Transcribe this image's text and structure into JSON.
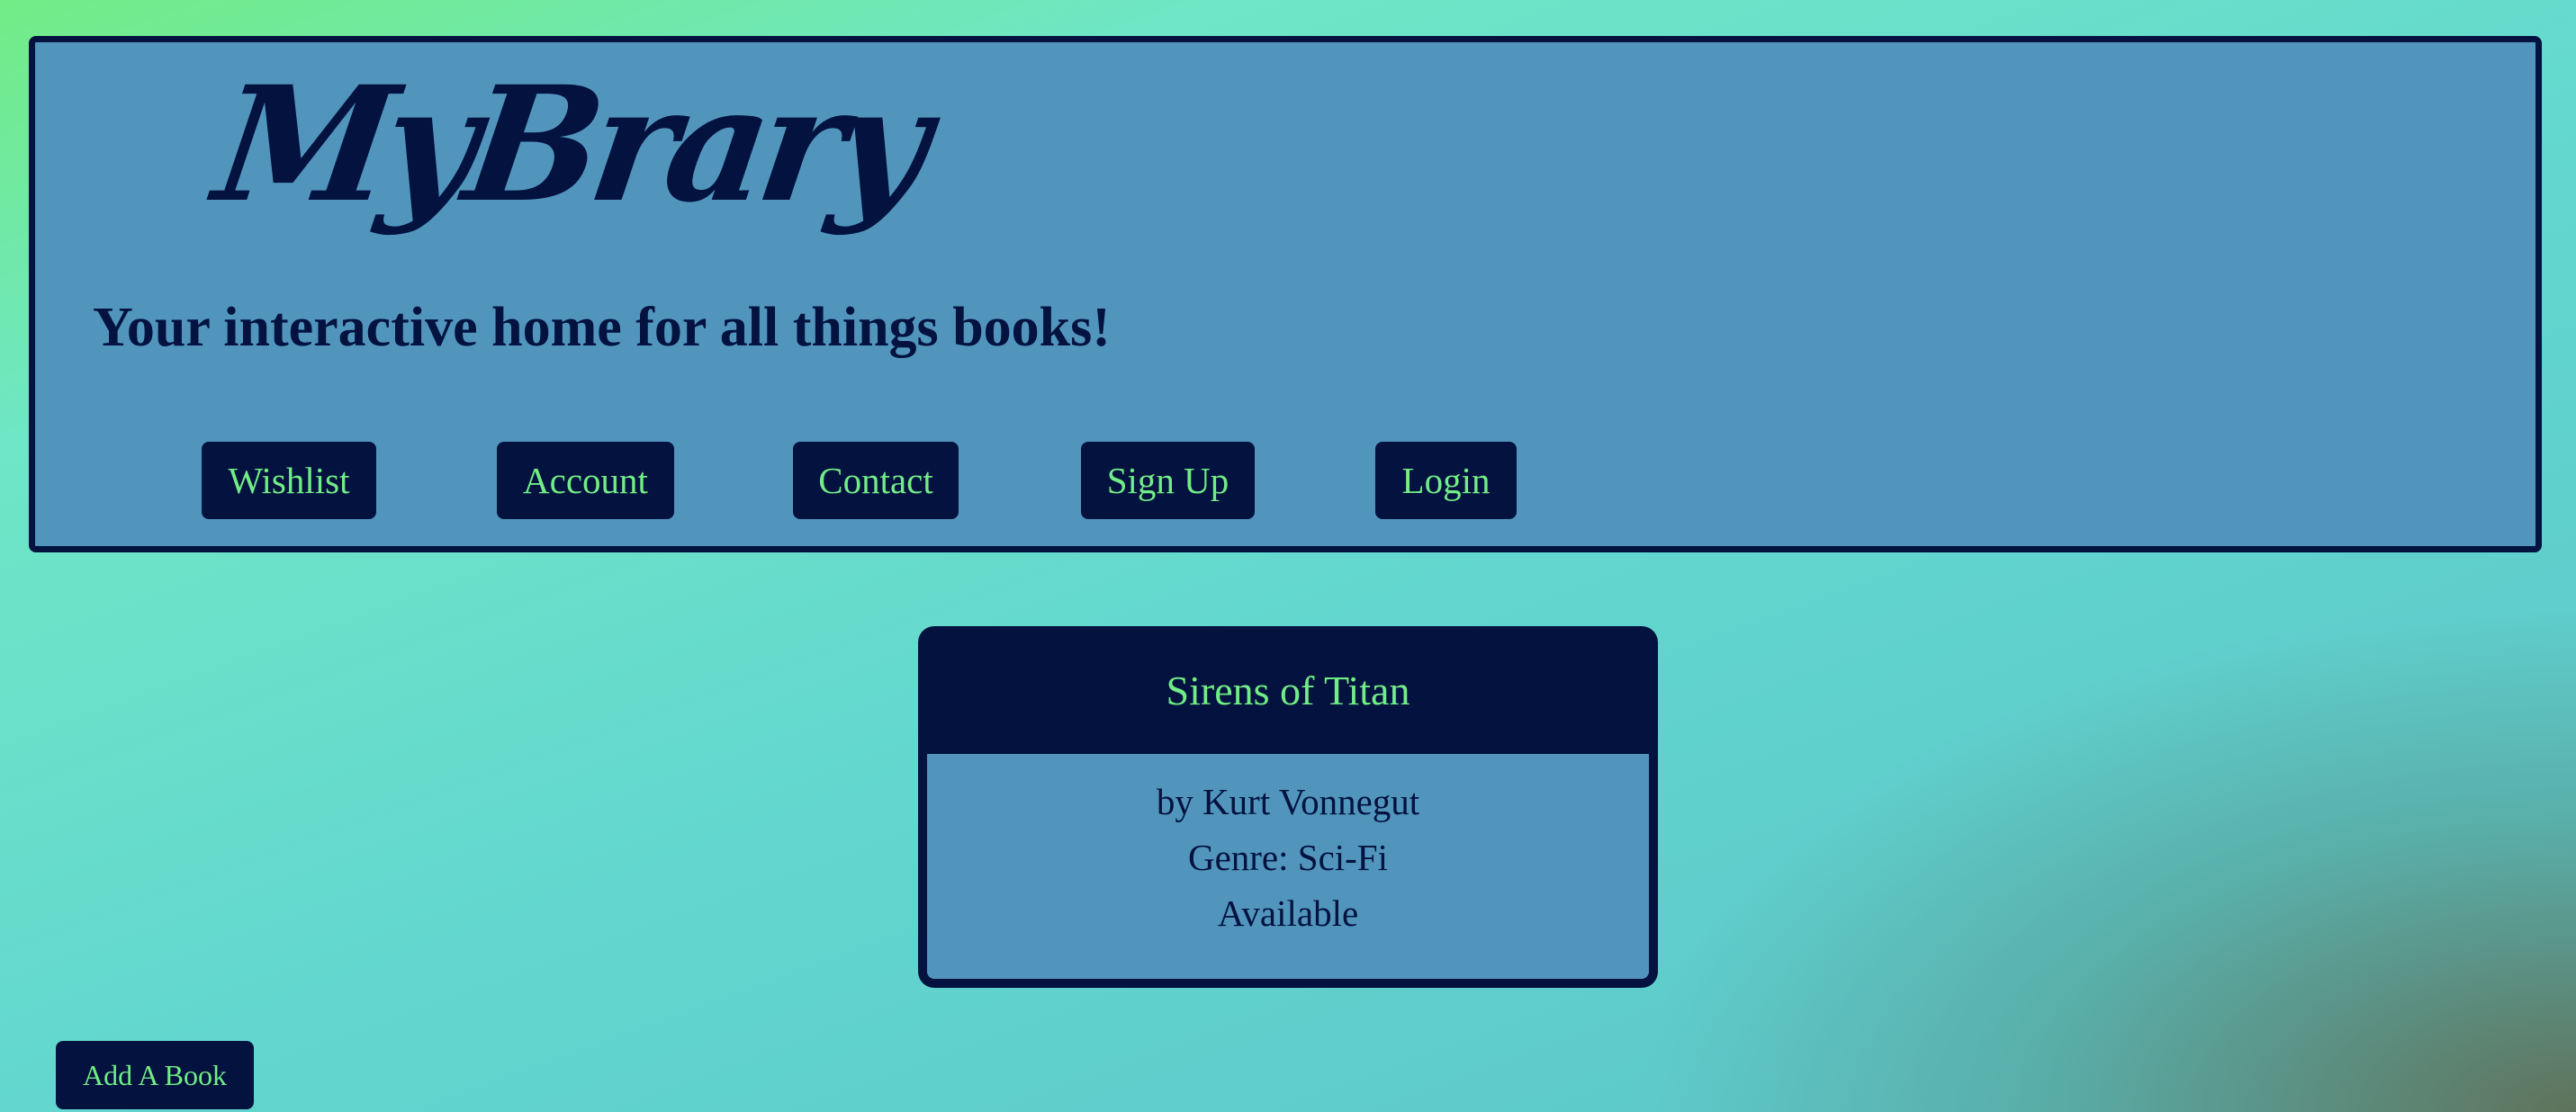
{
  "header": {
    "logo": "MyBrary",
    "tagline": "Your interactive home for all things books!",
    "nav": [
      {
        "label": "Wishlist"
      },
      {
        "label": "Account"
      },
      {
        "label": "Contact"
      },
      {
        "label": "Sign Up"
      },
      {
        "label": "Login"
      }
    ]
  },
  "book": {
    "title": "Sirens of Titan",
    "author": "by Kurt Vonnegut",
    "genre": "Genre: Sci-Fi",
    "status": "Available"
  },
  "actions": {
    "add_book_label": "Add A Book"
  },
  "colors": {
    "navy": "#03123f",
    "panel_blue": "#5195bd",
    "accent_green": "#72ec86"
  }
}
